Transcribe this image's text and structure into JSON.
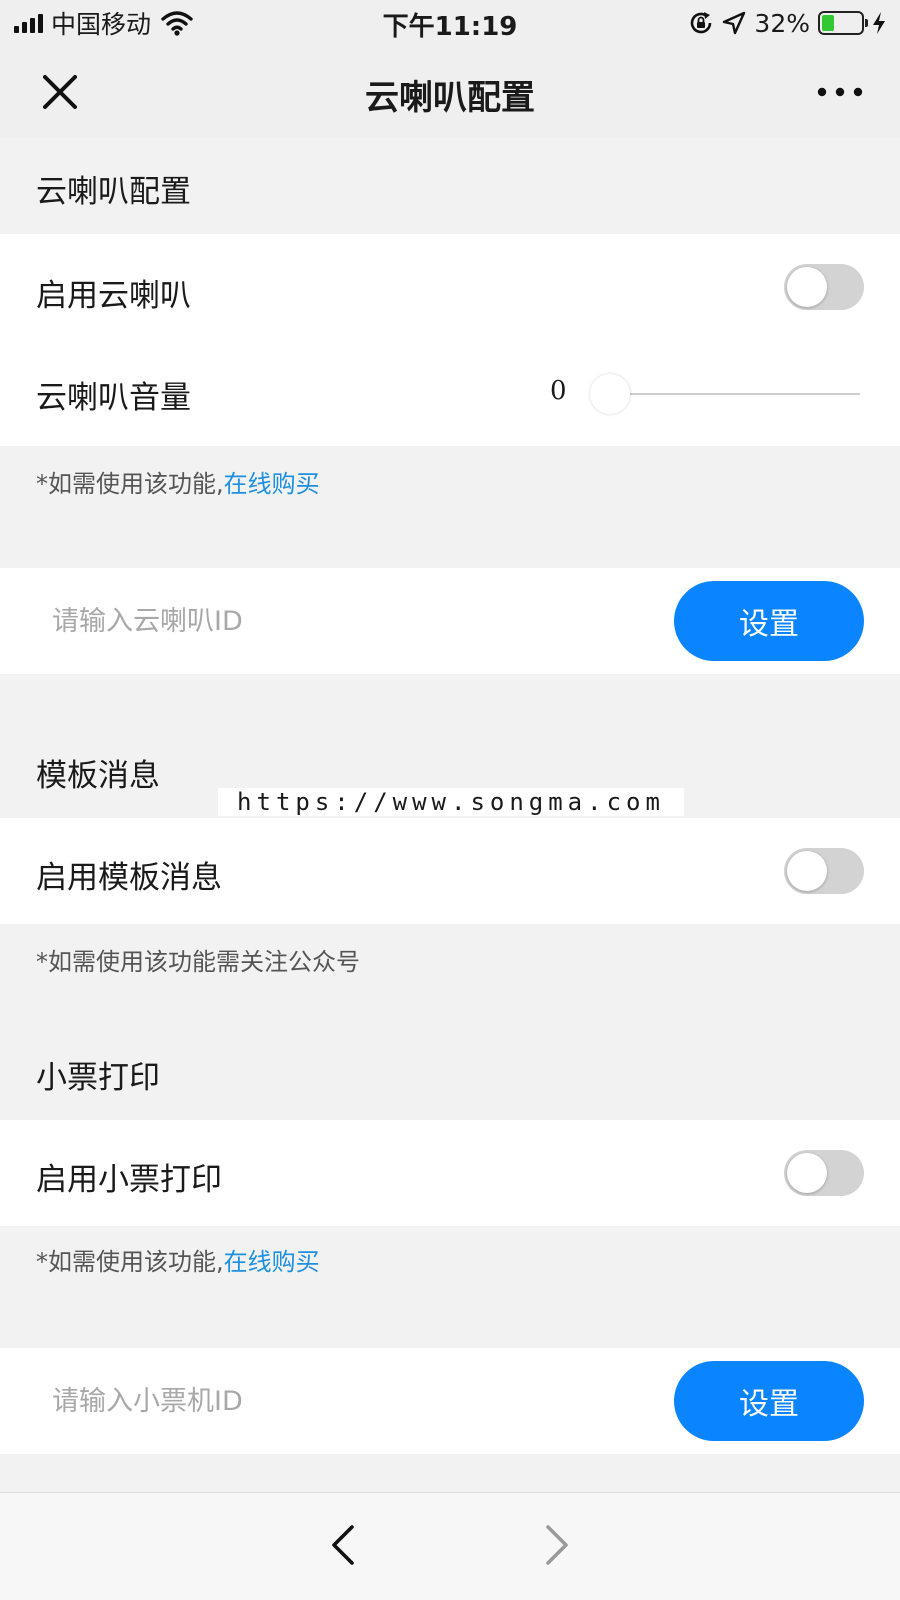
{
  "status_bar": {
    "carrier": "中国移动",
    "time": "下午11:19",
    "battery_percent": "32%",
    "battery_level": 0.32,
    "icons": [
      "signal-icon",
      "wifi-icon",
      "rotation-lock-icon",
      "location-icon",
      "battery-icon",
      "charging-icon"
    ]
  },
  "nav": {
    "title": "云喇叭配置",
    "close_icon": "close-icon",
    "more_icon": "more-icon"
  },
  "speaker": {
    "section_title": "云喇叭配置",
    "enable_label": "启用云喇叭",
    "enable_on": false,
    "volume_label": "云喇叭音量",
    "volume_value": "0",
    "note_prefix": "*如需使用该功能,",
    "note_link": "在线购买",
    "id_placeholder": "请输入云喇叭ID",
    "set_label": "设置"
  },
  "template": {
    "section_title": "模板消息",
    "enable_label": "启用模板消息",
    "enable_on": false,
    "note": "*如需使用该功能需关注公众号"
  },
  "watermark": "https://www.songma.com",
  "receipt": {
    "section_title": "小票打印",
    "enable_label": "启用小票打印",
    "enable_on": false,
    "note_prefix": "*如需使用该功能,",
    "note_link": "在线购买",
    "id_placeholder": "请输入小票机ID",
    "set_label": "设置"
  },
  "bottom_nav": {
    "back_icon": "back-arrow-icon",
    "forward_icon": "forward-arrow-icon"
  },
  "colors": {
    "accent": "#0a84ff",
    "link": "#1e90e0",
    "toggle_off": "#d3d3d3",
    "battery_green": "#32c832"
  }
}
